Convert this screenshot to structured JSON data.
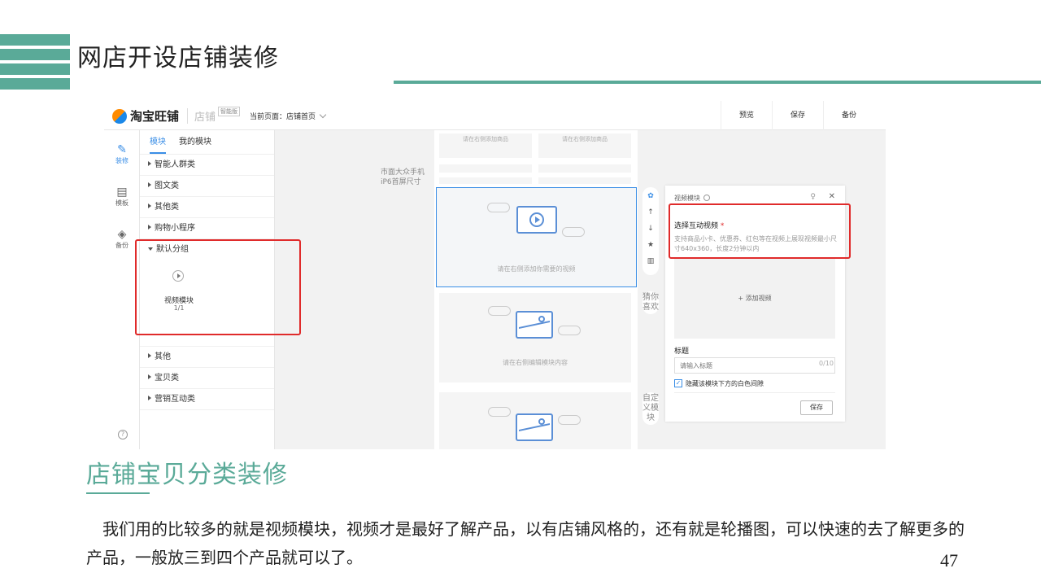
{
  "slide": {
    "title": "网店开设店铺装修",
    "section_title": "店铺宝贝分类装修",
    "body": "我们用的比较多的就是视频模块，视频才是最好了解产品，以有店铺风格的，还有就是轮播图，可以快速的去了解更多的产品，一般放三到四个产品就可以了。",
    "page_number": "47",
    "accent_color": "#5aaa98"
  },
  "editor": {
    "brand": "淘宝旺铺",
    "brand_sub": "店铺",
    "brand_badge": "智能版",
    "current_page_label": "当前页面：店铺首页",
    "actions": {
      "preview": "预览",
      "save": "保存",
      "backup": "备份"
    },
    "iconbar": {
      "decorate": "装修",
      "template": "模板",
      "backup": "备份",
      "help": "?"
    },
    "tabs": {
      "modules": "模块",
      "my_modules": "我的模块"
    },
    "categories_top": [
      "智能人群类",
      "图文类",
      "其他类",
      "购物小程序"
    ],
    "default_group": "默认分组",
    "video_module_label": "视频模块",
    "video_module_count": "1/1",
    "categories_bottom": [
      "其他",
      "宝贝类",
      "营销互动类"
    ],
    "canvas": {
      "screen_note_1": "市面大众手机",
      "screen_note_2": "iP6首屏尺寸",
      "add_goods": "请在右侧添加商品",
      "video_placeholder": "请在右侧添加你需要的视频",
      "edit_placeholder": "请在右侧编辑模块内容"
    },
    "tool_icons": [
      "gear-icon",
      "arrow-up-icon",
      "arrow-down-icon",
      "star-icon",
      "trash-icon"
    ],
    "side_tabs": {
      "guess": "猜你喜欢",
      "custom": "自定义模块"
    },
    "video_panel": {
      "header": "视频模块",
      "select_label": "选择互动视频",
      "required_mark": "*",
      "hint": "支持商品小卡、优惠券、红包等在视频上展现视频最小尺寸640x360，长度2分钟以内",
      "add_video": "+ 添加视频",
      "title_label": "标题",
      "title_placeholder": "请输入标题",
      "title_count": "0/10",
      "hide_gap_label": "隐藏该模块下方的白色间隙",
      "hide_gap_checked": true,
      "save": "保存"
    }
  }
}
